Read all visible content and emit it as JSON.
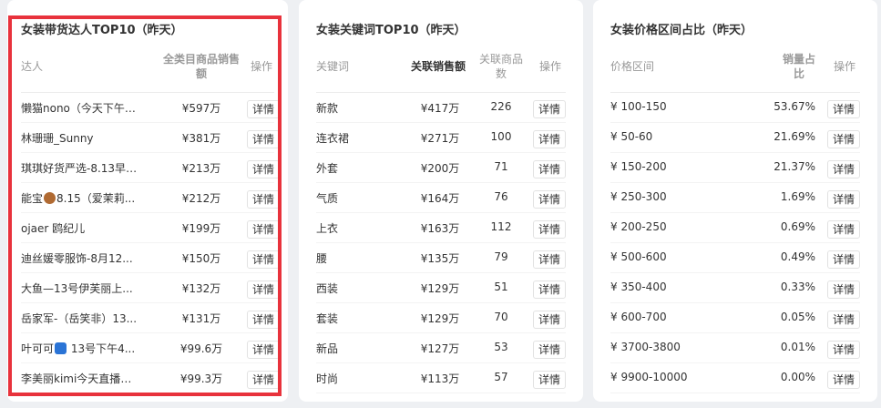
{
  "panel1": {
    "title": "女装带货达人TOP10（昨天）",
    "col_name": "达人",
    "col_sales_l1": "全类目商品销售",
    "col_sales_l2": "额",
    "col_action": "操作",
    "rows": [
      {
        "pre": "懒猫nono（今天下午1...",
        "icon": "",
        "post": "",
        "value": "¥597万",
        "btn": "详情"
      },
      {
        "pre": "林珊珊_Sunny",
        "icon": "",
        "post": "",
        "value": "¥381万",
        "btn": "详情"
      },
      {
        "pre": "琪琪好货严选-8.13早6...",
        "icon": "",
        "post": "",
        "value": "¥213万",
        "btn": "详情"
      },
      {
        "pre": "能宝",
        "icon": "bear-emoji-icon",
        "post": "8.15（爱茉莉...",
        "value": "¥212万",
        "btn": "详情"
      },
      {
        "pre": "ojaer 鸥纪儿",
        "icon": "",
        "post": "",
        "value": "¥199万",
        "btn": "详情"
      },
      {
        "pre": "迪丝媛零服饰-8月12...",
        "icon": "",
        "post": "",
        "value": "¥150万",
        "btn": "详情"
      },
      {
        "pre": "大鱼—13号伊芙丽上...",
        "icon": "",
        "post": "",
        "value": "¥132万",
        "btn": "详情"
      },
      {
        "pre": "岳家军-（岳笑非）13...",
        "icon": "",
        "post": "",
        "value": "¥131万",
        "btn": "详情"
      },
      {
        "pre": "叶可可",
        "icon": "glove-emoji-icon",
        "post": " 13号下午4...",
        "value": "¥99.6万",
        "btn": "详情"
      },
      {
        "pre": "李美丽kimi今天直播临...",
        "icon": "",
        "post": "",
        "value": "¥99.3万",
        "btn": "详情"
      }
    ]
  },
  "panel2": {
    "title": "女装关键词TOP10（昨天）",
    "col_keyword": "关键词",
    "col_sales": "关联销售额",
    "col_count_l1": "关联商品",
    "col_count_l2": "数",
    "col_action": "操作",
    "rows": [
      {
        "kw": "新款",
        "sales": "¥417万",
        "count": "226",
        "btn": "详情"
      },
      {
        "kw": "连衣裙",
        "sales": "¥271万",
        "count": "100",
        "btn": "详情"
      },
      {
        "kw": "外套",
        "sales": "¥200万",
        "count": "71",
        "btn": "详情"
      },
      {
        "kw": "气质",
        "sales": "¥164万",
        "count": "76",
        "btn": "详情"
      },
      {
        "kw": "上衣",
        "sales": "¥163万",
        "count": "112",
        "btn": "详情"
      },
      {
        "kw": "腰",
        "sales": "¥135万",
        "count": "79",
        "btn": "详情"
      },
      {
        "kw": "西装",
        "sales": "¥129万",
        "count": "51",
        "btn": "详情"
      },
      {
        "kw": "套装",
        "sales": "¥129万",
        "count": "70",
        "btn": "详情"
      },
      {
        "kw": "新品",
        "sales": "¥127万",
        "count": "53",
        "btn": "详情"
      },
      {
        "kw": "时尚",
        "sales": "¥113万",
        "count": "57",
        "btn": "详情"
      }
    ]
  },
  "panel3": {
    "title": "女装价格区间占比（昨天）",
    "col_range": "价格区间",
    "col_share_l1": "销量占",
    "col_share_l2": "比",
    "col_action": "操作",
    "rows": [
      {
        "range": "¥ 100-150",
        "share": "53.67%",
        "btn": "详情"
      },
      {
        "range": "¥ 50-60",
        "share": "21.69%",
        "btn": "详情"
      },
      {
        "range": "¥ 150-200",
        "share": "21.37%",
        "btn": "详情"
      },
      {
        "range": "¥ 250-300",
        "share": "1.69%",
        "btn": "详情"
      },
      {
        "range": "¥ 200-250",
        "share": "0.69%",
        "btn": "详情"
      },
      {
        "range": "¥ 500-600",
        "share": "0.49%",
        "btn": "详情"
      },
      {
        "range": "¥ 350-400",
        "share": "0.33%",
        "btn": "详情"
      },
      {
        "range": "¥ 600-700",
        "share": "0.05%",
        "btn": "详情"
      },
      {
        "range": "¥ 3700-3800",
        "share": "0.01%",
        "btn": "详情"
      },
      {
        "range": "¥ 9900-10000",
        "share": "0.00%",
        "btn": "详情"
      }
    ]
  }
}
